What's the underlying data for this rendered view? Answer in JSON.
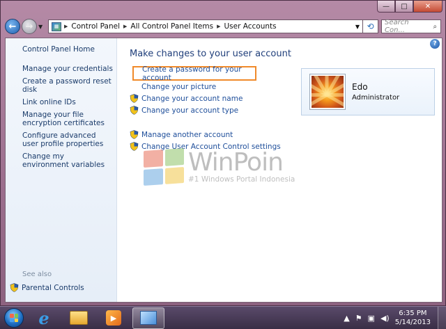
{
  "window": {
    "caption": {
      "minimize": "—",
      "maximize": "□",
      "close": "✕"
    }
  },
  "nav": {
    "back": "←",
    "forward": "→",
    "breadcrumb": [
      "Control Panel",
      "All Control Panel Items",
      "User Accounts"
    ],
    "refresh": "⟲",
    "search_placeholder": "Search Con...",
    "search_icon": "⌕"
  },
  "sidebar": {
    "home": "Control Panel Home",
    "items": [
      "Manage your credentials",
      "Create a password reset disk",
      "Link online IDs",
      "Manage your file encryption certificates",
      "Configure advanced user profile properties",
      "Change my environment variables"
    ],
    "see_also": "See also",
    "parental_controls": "Parental Controls"
  },
  "main": {
    "title": "Make changes to your user account",
    "help": "?",
    "tasks": [
      {
        "label": "Create a password for your account",
        "shield": false,
        "highlighted": true
      },
      {
        "label": "Change your picture",
        "shield": false
      },
      {
        "label": "Change your account name",
        "shield": true
      },
      {
        "label": "Change your account type",
        "shield": true
      }
    ],
    "tasks2": [
      {
        "label": "Manage another account",
        "shield": true
      },
      {
        "label": "Change User Account Control settings",
        "shield": true
      }
    ]
  },
  "user": {
    "name": "Edo",
    "role": "Administrator"
  },
  "watermark": {
    "title": "WinPoin",
    "subtitle": "#1 Windows Portal Indonesia"
  },
  "taskbar": {
    "clock_time": "6:35 PM",
    "clock_date": "5/14/2013"
  },
  "colors": {
    "link": "#1e4e9a",
    "highlight_border": "#f08a2a",
    "title": "#1f3e7a"
  }
}
